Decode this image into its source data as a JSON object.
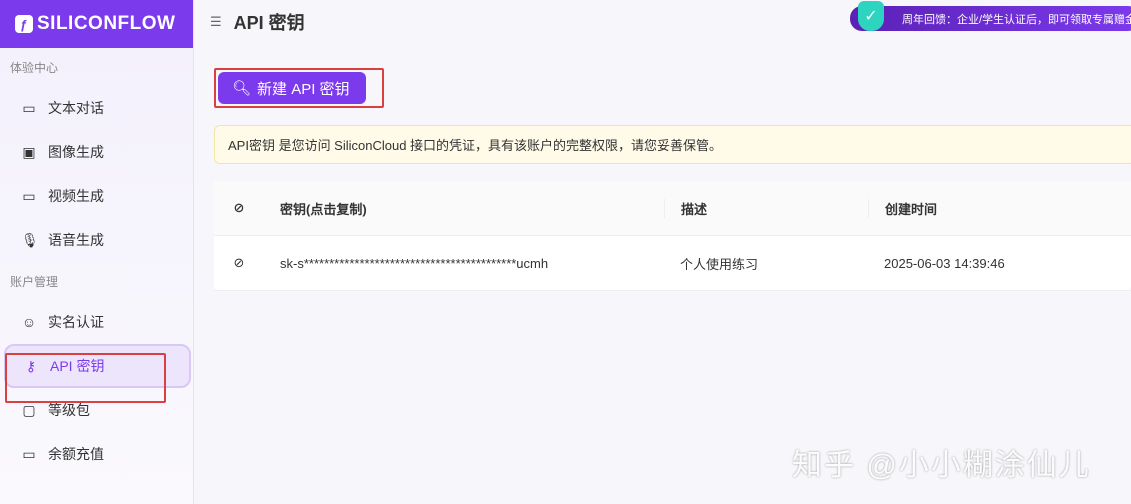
{
  "brand": "SILICONFLOW",
  "sidebar": {
    "groups": [
      {
        "label": "体验中心",
        "items": [
          {
            "label": "文本对话",
            "icon": "chat-icon"
          },
          {
            "label": "图像生成",
            "icon": "image-icon"
          },
          {
            "label": "视频生成",
            "icon": "video-icon"
          },
          {
            "label": "语音生成",
            "icon": "mic-icon"
          }
        ]
      },
      {
        "label": "账户管理",
        "items": [
          {
            "label": "实名认证",
            "icon": "user-check-icon"
          },
          {
            "label": "API 密钥",
            "icon": "key-icon",
            "active": true
          },
          {
            "label": "等级包",
            "icon": "wallet-icon"
          },
          {
            "label": "余额充值",
            "icon": "card-icon"
          }
        ]
      }
    ]
  },
  "header": {
    "title": "API 密钥"
  },
  "banner": {
    "text": "周年回馈：企业/学生认证后，即可领取专属赠金"
  },
  "new_key_button": "新建 API 密钥",
  "notice": "API密钥 是您访问 SiliconCloud 接口的凭证，具有该账户的完整权限，请您妥善保管。",
  "table": {
    "columns": [
      "密钥(点击复制)",
      "描述",
      "创建时间"
    ],
    "rows": [
      {
        "key": "sk-s******************************************ucmh",
        "description": "个人使用练习",
        "created": "2025-06-03 14:39:46"
      }
    ]
  },
  "watermark": "知乎 @小小糊涂仙儿"
}
